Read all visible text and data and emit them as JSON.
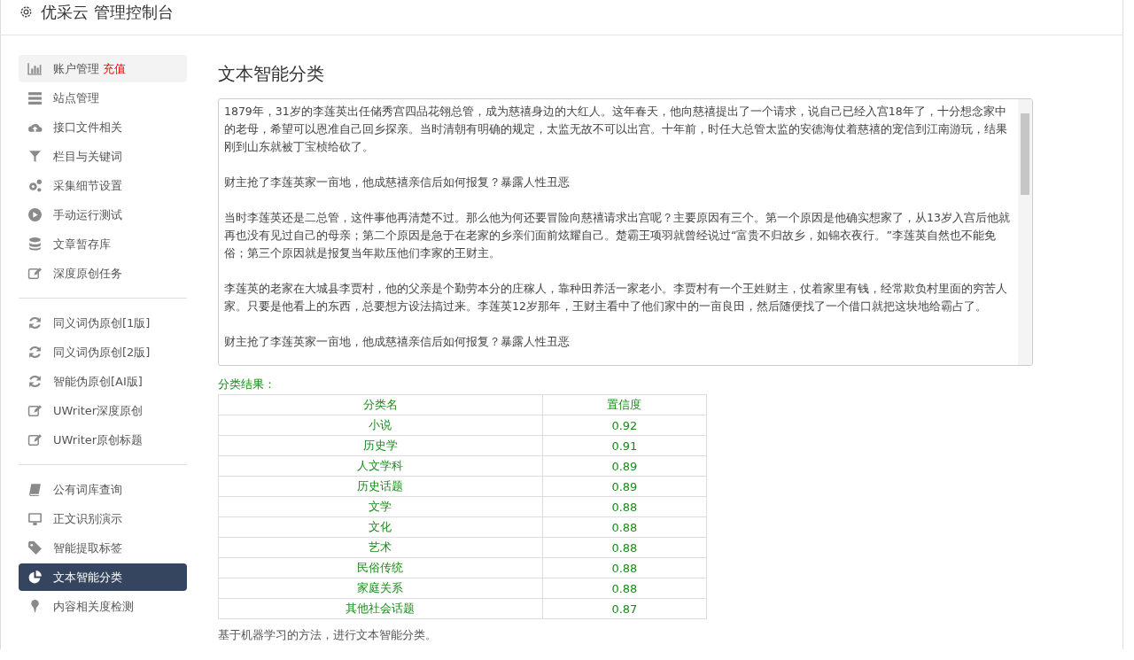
{
  "header": {
    "title": "优采云 管理控制台"
  },
  "sidebar": {
    "groups": [
      {
        "items": [
          {
            "label": "账户管理",
            "badge": "充值",
            "hover": true,
            "selected": false
          },
          {
            "label": "站点管理",
            "hover": false,
            "selected": false
          },
          {
            "label": "接口文件相关",
            "hover": false,
            "selected": false
          },
          {
            "label": "栏目与关键词",
            "hover": false,
            "selected": false
          },
          {
            "label": "采集细节设置",
            "hover": false,
            "selected": false
          },
          {
            "label": "手动运行测试",
            "hover": false,
            "selected": false
          },
          {
            "label": "文章暂存库",
            "hover": false,
            "selected": false
          },
          {
            "label": "深度原创任务",
            "hover": false,
            "selected": false
          }
        ]
      },
      {
        "items": [
          {
            "label": "同义词伪原创[1版]",
            "hover": false,
            "selected": false
          },
          {
            "label": "同义词伪原创[2版]",
            "hover": false,
            "selected": false
          },
          {
            "label": "智能伪原创[AI版]",
            "hover": false,
            "selected": false
          },
          {
            "label": "UWriter深度原创",
            "hover": false,
            "selected": false
          },
          {
            "label": "UWriter原创标题",
            "hover": false,
            "selected": false
          }
        ]
      },
      {
        "items": [
          {
            "label": "公有词库查询",
            "hover": false,
            "selected": false
          },
          {
            "label": "正文识别演示",
            "hover": false,
            "selected": false
          },
          {
            "label": "智能提取标签",
            "hover": false,
            "selected": false
          },
          {
            "label": "文本智能分类",
            "hover": false,
            "selected": true
          },
          {
            "label": "内容相关度检测",
            "hover": false,
            "selected": false
          }
        ]
      }
    ]
  },
  "main": {
    "title": "文本智能分类",
    "text_input": {
      "paragraphs": [
        "1879年，31岁的李莲英出任储秀宫四品花翎总管，成为慈禧身边的大红人。这年春天，他向慈禧提出了一个请求，说自己已经入宫18年了，十分想念家中的老母，希望可以恩准自己回乡探亲。当时清朝有明确的规定，太监无故不可以出宫。十年前，时任大总管太监的安德海仗着慈禧的宠信到江南游玩，结果刚到山东就被丁宝桢给砍了。",
        "财主抢了李莲英家一亩地，他成慈禧亲信后如何报复？暴露人性丑恶",
        "当时李莲英还是二总管，这件事他再清楚不过。那么他为何还要冒险向慈禧请求出宫呢？主要原因有三个。第一个原因是他确实想家了，从13岁入宫后他就再也没有见过自己的母亲；第二个原因是急于在老家的乡亲们面前炫耀自己。楚霸王项羽就曾经说过“富贵不归故乡，如锦衣夜行。”李莲英自然也不能免俗；第三个原因就是报复当年欺压他们李家的王财主。",
        "李莲英的老家在大城县李贾村，他的父亲是个勤劳本分的庄稼人，靠种田养活一家老小。李贾村有一个王姓财主，仗着家里有钱，经常欺负村里面的穷苦人家。只要是他看上的东西，总要想方设法搞过来。李莲英12岁那年，王财主看中了他们家中的一亩良田，然后随便找了一个借口就把这块地给霸占了。",
        "财主抢了李莲英家一亩地，他成慈禧亲信后如何报复？暴露人性丑恶"
      ]
    },
    "result_label": "分类结果：",
    "table": {
      "columns": [
        "分类名",
        "置信度"
      ],
      "rows": [
        [
          "小说",
          "0.92"
        ],
        [
          "历史学",
          "0.91"
        ],
        [
          "人文学科",
          "0.89"
        ],
        [
          "历史话题",
          "0.89"
        ],
        [
          "文学",
          "0.88"
        ],
        [
          "文化",
          "0.88"
        ],
        [
          "艺术",
          "0.88"
        ],
        [
          "民俗传统",
          "0.88"
        ],
        [
          "家庭关系",
          "0.88"
        ],
        [
          "其他社会话题",
          "0.87"
        ]
      ]
    },
    "footer_note": "基于机器学习的方法，进行文本智能分类。"
  }
}
